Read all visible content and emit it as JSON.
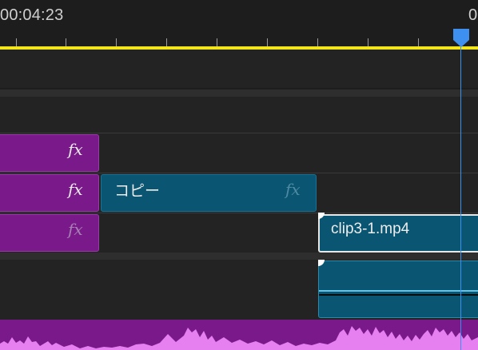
{
  "ruler": {
    "timecode": "00:04:23",
    "cut_timecode": "0"
  },
  "clips": {
    "v3_left": {
      "fx": "fx"
    },
    "v2_left": {
      "fx": "fx"
    },
    "v2_copy": {
      "name": "コピー",
      "fx": "fx"
    },
    "v1_left": {
      "fx": "fx"
    },
    "v1_clip": {
      "name": "clip3-1.mp4"
    }
  },
  "colors": {
    "work_area": "#f2e61b",
    "playhead": "#3d8ff0",
    "purple_clip": "#7a1a8a",
    "teal_clip": "#0a5571"
  }
}
